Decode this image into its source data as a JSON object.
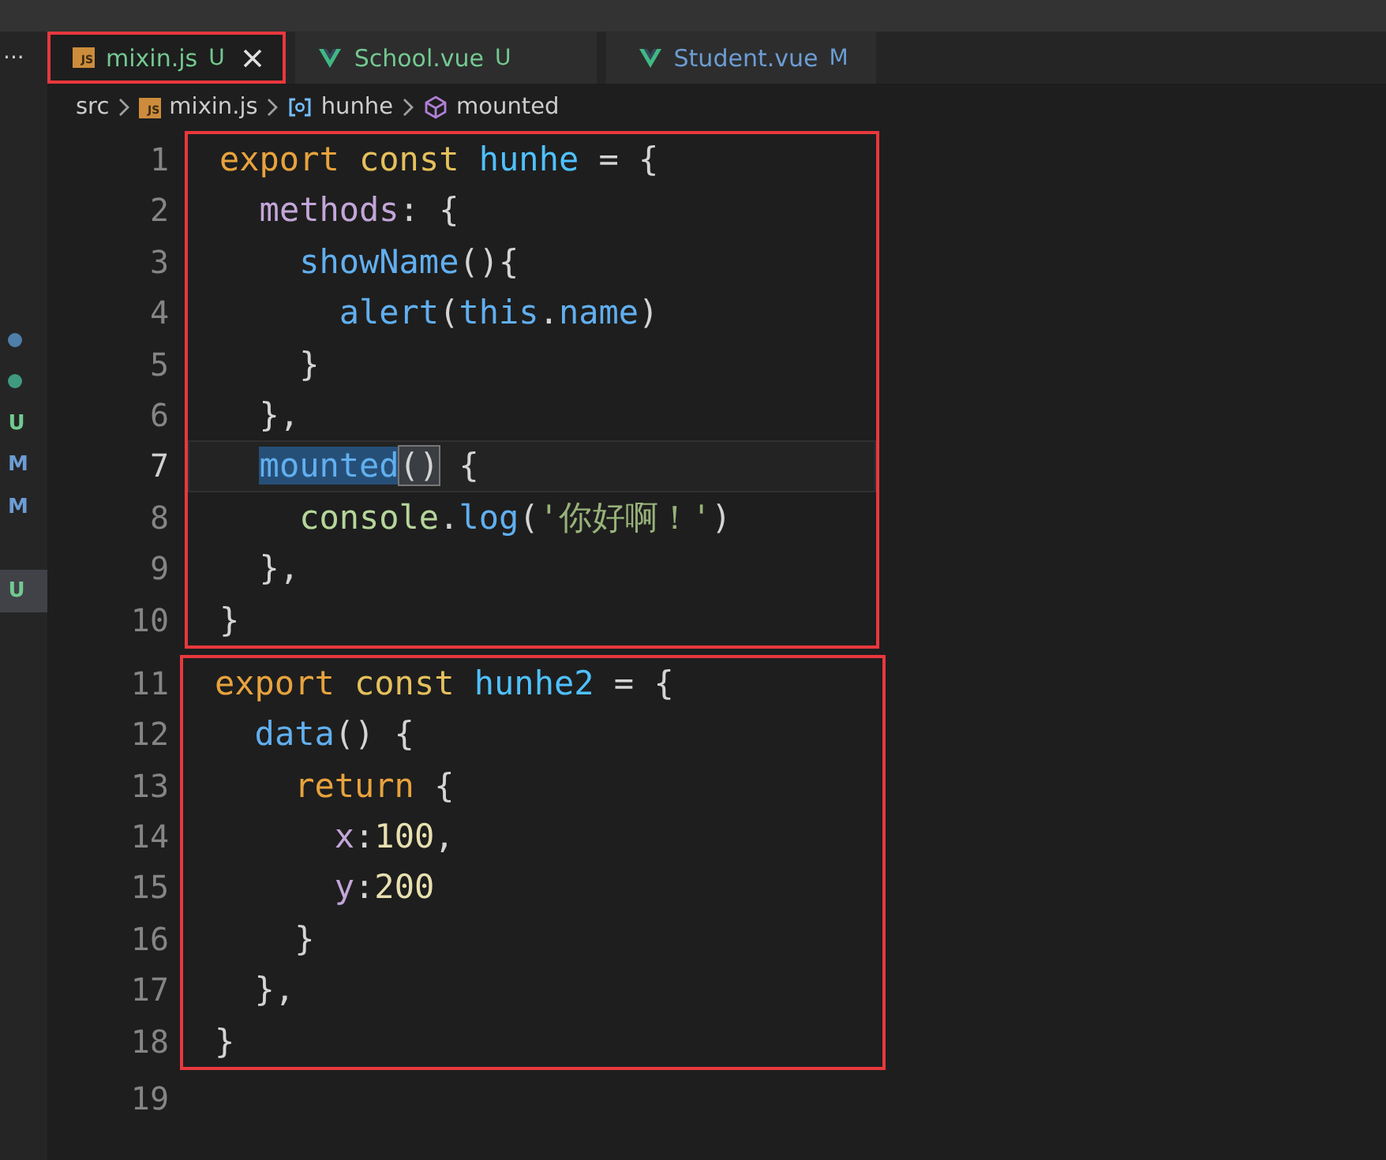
{
  "tabs": [
    {
      "kind": "js",
      "icon_label": "JS",
      "label": "mixin.js",
      "status": "U",
      "color": "#73c991",
      "selected": true,
      "annotated": true
    },
    {
      "kind": "vue",
      "label": "School.vue",
      "status": "U",
      "color": "#73c991",
      "selected": false,
      "annotated": false
    },
    {
      "kind": "vue",
      "label": "Student.vue",
      "status": "M",
      "color": "#6c9dd4",
      "selected": false,
      "annotated": false
    }
  ],
  "overflow": "···",
  "breadcrumb": [
    {
      "kind": "folder",
      "text": "src"
    },
    {
      "kind": "file",
      "text": "mixin.js",
      "icon_label": "JS"
    },
    {
      "kind": "variable",
      "text": "hunhe"
    },
    {
      "kind": "method",
      "text": "mounted"
    }
  ],
  "gutter_markers": [
    {
      "kind": "dot",
      "color": "#4e7fa8",
      "selected": false
    },
    {
      "kind": "dot",
      "color": "#3f9a80",
      "selected": false
    },
    {
      "kind": "letter",
      "text": "U",
      "color": "#73c991",
      "selected": false
    },
    {
      "kind": "letter",
      "text": "M",
      "color": "#6c9dd4",
      "selected": false
    },
    {
      "kind": "letter",
      "text": "M",
      "color": "#6c9dd4",
      "selected": false
    },
    {
      "kind": "blank"
    },
    {
      "kind": "letter",
      "text": "U",
      "color": "#73c991",
      "selected": true
    }
  ],
  "blocks": [
    {
      "boxed": true,
      "lines": [
        {
          "number": "1",
          "current": false,
          "tokens": [
            {
              "kind": "keyword",
              "text": "export"
            },
            {
              "kind": "storage",
              "text": " const"
            },
            {
              "kind": "constant",
              "text": " hunhe"
            },
            {
              "kind": "plain",
              "text": " = {"
            }
          ]
        },
        {
          "number": "2",
          "current": false,
          "tokens": [
            {
              "kind": "property",
              "text": "  methods"
            },
            {
              "kind": "plain",
              "text": ": {"
            }
          ]
        },
        {
          "number": "3",
          "current": false,
          "tokens": [
            {
              "kind": "function",
              "text": "    showName"
            },
            {
              "kind": "plain",
              "text": "(){"
            }
          ]
        },
        {
          "number": "4",
          "current": false,
          "tokens": [
            {
              "kind": "function",
              "text": "      alert"
            },
            {
              "kind": "plain",
              "text": "("
            },
            {
              "kind": "variable",
              "text": "this"
            },
            {
              "kind": "plain",
              "text": "."
            },
            {
              "kind": "variable",
              "text": "name"
            },
            {
              "kind": "plain",
              "text": ")"
            }
          ]
        },
        {
          "number": "5",
          "current": false,
          "tokens": [
            {
              "kind": "plain",
              "text": "    }"
            }
          ]
        },
        {
          "number": "6",
          "current": false,
          "tokens": [
            {
              "kind": "plain",
              "text": "  },"
            }
          ]
        },
        {
          "number": "7",
          "current": true,
          "tokens": [
            {
              "kind": "selection",
              "text": "  mounted"
            },
            {
              "kind": "bracket-match",
              "text": "()"
            },
            {
              "kind": "plain",
              "text": " {"
            }
          ]
        },
        {
          "number": "8",
          "current": false,
          "tokens": [
            {
              "kind": "object",
              "text": "    console"
            },
            {
              "kind": "plain",
              "text": "."
            },
            {
              "kind": "function",
              "text": "log"
            },
            {
              "kind": "plain",
              "text": "("
            },
            {
              "kind": "string",
              "text": "'你好啊！'"
            },
            {
              "kind": "plain",
              "text": ")"
            }
          ]
        },
        {
          "number": "9",
          "current": false,
          "tokens": [
            {
              "kind": "plain",
              "text": "  },"
            }
          ]
        },
        {
          "number": "10",
          "current": false,
          "tokens": [
            {
              "kind": "plain",
              "text": "}"
            }
          ]
        }
      ]
    },
    {
      "boxed": true,
      "lines": [
        {
          "number": "11",
          "current": false,
          "tokens": [
            {
              "kind": "keyword",
              "text": "export"
            },
            {
              "kind": "storage",
              "text": " const"
            },
            {
              "kind": "constant",
              "text": " hunhe2"
            },
            {
              "kind": "plain",
              "text": " = {"
            }
          ]
        },
        {
          "number": "12",
          "current": false,
          "tokens": [
            {
              "kind": "function",
              "text": "  data"
            },
            {
              "kind": "plain",
              "text": "() {"
            }
          ]
        },
        {
          "number": "13",
          "current": false,
          "tokens": [
            {
              "kind": "keyword",
              "text": "    return"
            },
            {
              "kind": "plain",
              "text": " {"
            }
          ]
        },
        {
          "number": "14",
          "current": false,
          "tokens": [
            {
              "kind": "property",
              "text": "      x"
            },
            {
              "kind": "plain",
              "text": ":"
            },
            {
              "kind": "number",
              "text": "100"
            },
            {
              "kind": "plain",
              "text": ","
            }
          ]
        },
        {
          "number": "15",
          "current": false,
          "tokens": [
            {
              "kind": "property",
              "text": "      y"
            },
            {
              "kind": "plain",
              "text": ":"
            },
            {
              "kind": "number",
              "text": "200"
            }
          ]
        },
        {
          "number": "16",
          "current": false,
          "tokens": [
            {
              "kind": "plain",
              "text": "    }"
            }
          ]
        },
        {
          "number": "17",
          "current": false,
          "tokens": [
            {
              "kind": "plain",
              "text": "  },"
            }
          ]
        },
        {
          "number": "18",
          "current": false,
          "tokens": [
            {
              "kind": "plain",
              "text": "}"
            }
          ]
        }
      ]
    },
    {
      "boxed": false,
      "lines": [
        {
          "number": "19",
          "current": false
        }
      ]
    }
  ]
}
